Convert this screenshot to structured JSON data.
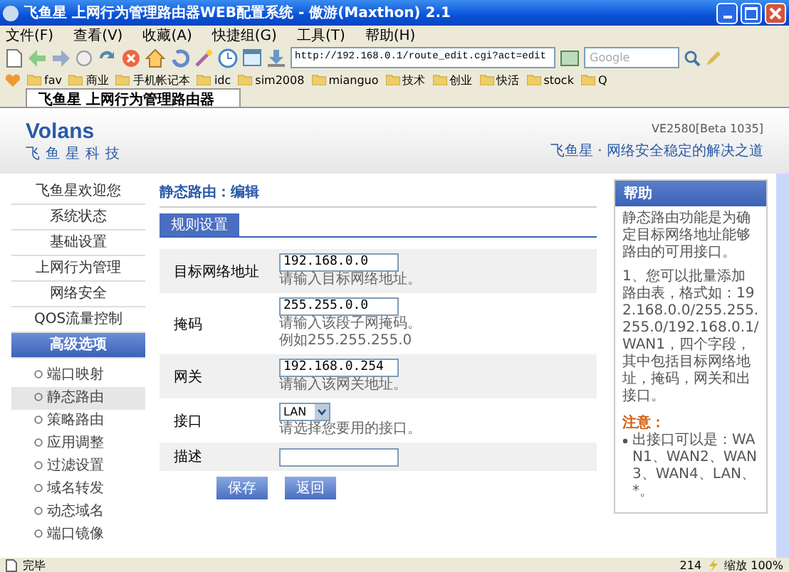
{
  "window": {
    "title": "飞鱼星 上网行为管理路由器WEB配置系统 - 傲游(Maxthon) 2.1"
  },
  "menu": [
    "文件(F)",
    "查看(V)",
    "收藏(A)",
    "快捷组(G)",
    "工具(T)",
    "帮助(H)"
  ],
  "address": {
    "value": "http://192.168.0.1/route_edit.cgi?act=edit"
  },
  "search": {
    "placeholder": "Google"
  },
  "bookmarks": [
    "fav",
    "商业",
    "手机帐记本",
    "idc",
    "sim2008",
    "mianguo",
    "技术",
    "创业",
    "快活",
    "stock",
    "Q"
  ],
  "tabs": [
    {
      "label": "飞鱼星 上网行为管理路由器",
      "selected": true
    }
  ],
  "header": {
    "logo": "Volans",
    "company": "飞鱼星科技",
    "version": "VE2580[Beta 1035]",
    "slogan": "飞鱼星 · 网络安全稳定的解决之道"
  },
  "sidebar": {
    "items": [
      {
        "label": "飞鱼星欢迎您",
        "selected": false
      },
      {
        "label": "系统状态",
        "selected": false
      },
      {
        "label": "基础设置",
        "selected": false
      },
      {
        "label": "上网行为管理",
        "selected": false
      },
      {
        "label": "网络安全",
        "selected": false
      },
      {
        "label": "QOS流量控制",
        "selected": false
      },
      {
        "label": "高级选项",
        "selected": true
      }
    ],
    "sub_items": [
      {
        "label": "端口映射",
        "selected": false
      },
      {
        "label": "静态路由",
        "selected": true
      },
      {
        "label": "策略路由",
        "selected": false
      },
      {
        "label": "应用调整",
        "selected": false
      },
      {
        "label": "过滤设置",
        "selected": false
      },
      {
        "label": "域名转发",
        "selected": false
      },
      {
        "label": "动态域名",
        "selected": false
      },
      {
        "label": "端口镜像",
        "selected": false
      }
    ]
  },
  "form": {
    "title": "静态路由：编辑",
    "tab": "规则设置",
    "fields": [
      {
        "kind": "input",
        "label": "目标网络地址",
        "value": "192.168.0.0",
        "hints": [
          "请输入目标网络地址。"
        ]
      },
      {
        "kind": "input",
        "label": "掩码",
        "value": "255.255.0.0",
        "hints": [
          "请输入该段子网掩码。",
          "例如255.255.255.0"
        ]
      },
      {
        "kind": "input",
        "label": "网关",
        "value": "192.168.0.254",
        "hints": [
          "请输入该网关地址。"
        ]
      },
      {
        "kind": "select",
        "label": "接口",
        "value": "LAN",
        "hints": [
          "请选择您要用的接口。"
        ]
      },
      {
        "kind": "input",
        "label": "描述"
      }
    ],
    "buttons": [
      "保存",
      "返回"
    ]
  },
  "help": {
    "title": "帮助",
    "paragraphs": [
      "静态路由功能是为确定目标网络地址能够路由的可用接口。",
      "1、您可以批量添加路由表，格式如：192.168.0.0/255.255.255.0/192.168.0.1/WAN1，四个字段，其中包括目标网络地址，掩码，网关和出接口。"
    ],
    "note_title": "注意：",
    "notes": [
      "出接口可以是：WAN1、WAN2、WAN3、WAN4、LAN、*。"
    ]
  },
  "status_bar": {
    "text": "完毕",
    "count": "214",
    "zoom": "缩放 100%"
  }
}
